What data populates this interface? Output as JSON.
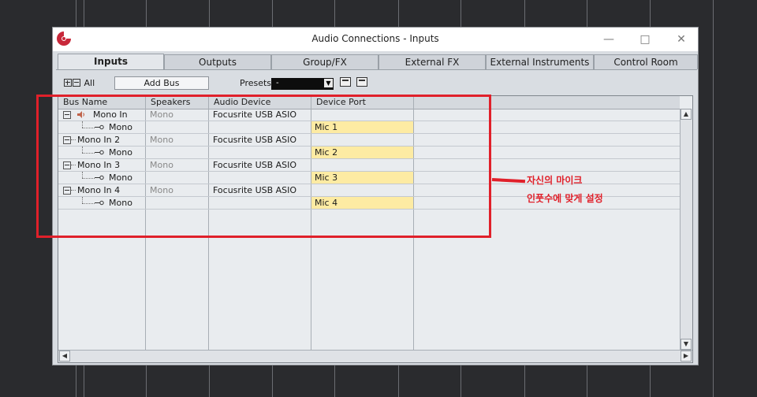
{
  "window": {
    "title": "Audio Connections - Inputs"
  },
  "tabs": [
    {
      "label": "Inputs",
      "active": true
    },
    {
      "label": "Outputs"
    },
    {
      "label": "Group/FX"
    },
    {
      "label": "External FX"
    },
    {
      "label": "External Instruments"
    },
    {
      "label": "Control Room"
    }
  ],
  "toolbar": {
    "all_label": "All",
    "add_bus_label": "Add Bus",
    "presets_label": "Presets",
    "presets_value": "-"
  },
  "table": {
    "columns": [
      "Bus Name",
      "Speakers",
      "Audio Device",
      "Device Port"
    ],
    "rows": [
      {
        "bus": "Mono In",
        "speakers": "Mono",
        "device": "Focusrite USB ASIO",
        "port": ""
      },
      {
        "bus": "Mono",
        "speakers": "",
        "device": "",
        "port": "Mic 1"
      },
      {
        "bus": "Mono In 2",
        "speakers": "Mono",
        "device": "Focusrite USB ASIO",
        "port": ""
      },
      {
        "bus": "Mono",
        "speakers": "",
        "device": "",
        "port": "Mic 2"
      },
      {
        "bus": "Mono In 3",
        "speakers": "Mono",
        "device": "Focusrite USB ASIO",
        "port": ""
      },
      {
        "bus": "Mono",
        "speakers": "",
        "device": "",
        "port": "Mic 3"
      },
      {
        "bus": "Mono In 4",
        "speakers": "Mono",
        "device": "Focusrite USB ASIO",
        "port": ""
      },
      {
        "bus": "Mono",
        "speakers": "",
        "device": "",
        "port": "Mic 4"
      }
    ]
  },
  "annotation": {
    "line1": "자신의 마이크",
    "line2": "인풋수에 맞게 설정",
    "color": "#e0202a"
  },
  "colors": {
    "port_highlight": "#fdeba3",
    "accent_logo": "#c8283a"
  }
}
